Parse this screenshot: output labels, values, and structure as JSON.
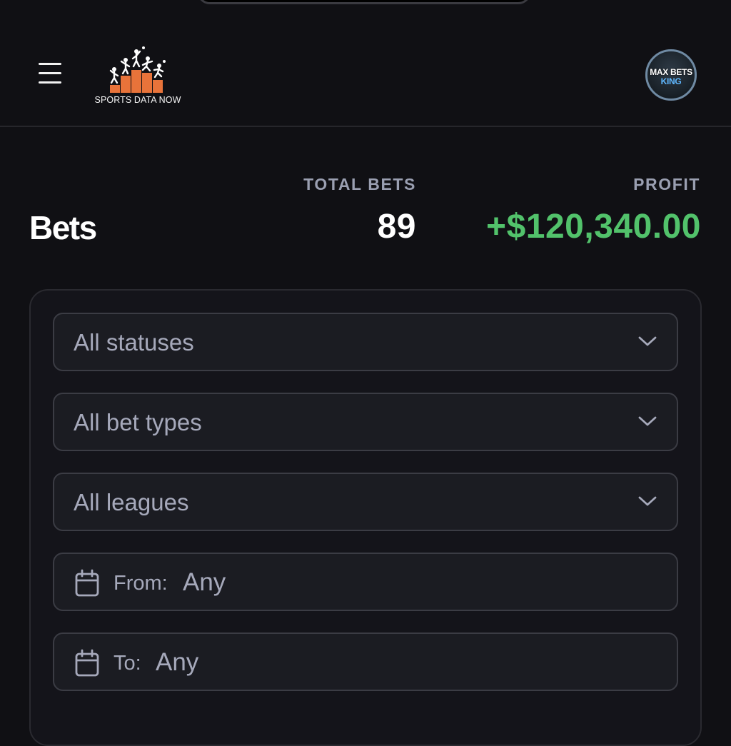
{
  "header": {
    "logo_text": "SPORTS DATA NOW",
    "avatar_line1": "MAX BETS",
    "avatar_line2": "KING"
  },
  "summary": {
    "page_title": "Bets",
    "total_bets_label": "TOTAL BETS",
    "total_bets_value": "89",
    "profit_label": "PROFIT",
    "profit_value": "+$120,340.00"
  },
  "filters": {
    "status_select": "All statuses",
    "bet_type_select": "All bet types",
    "league_select": "All leagues",
    "from_label": "From:",
    "from_value": "Any",
    "to_label": "To:",
    "to_value": "Any"
  },
  "colors": {
    "background": "#101014",
    "profit_positive": "#52c26b",
    "logo_accent": "#e8733a",
    "muted_text": "#9a9fb1"
  },
  "icons": [
    "menu-icon",
    "logo-icon",
    "chevron-down-icon",
    "calendar-icon"
  ]
}
